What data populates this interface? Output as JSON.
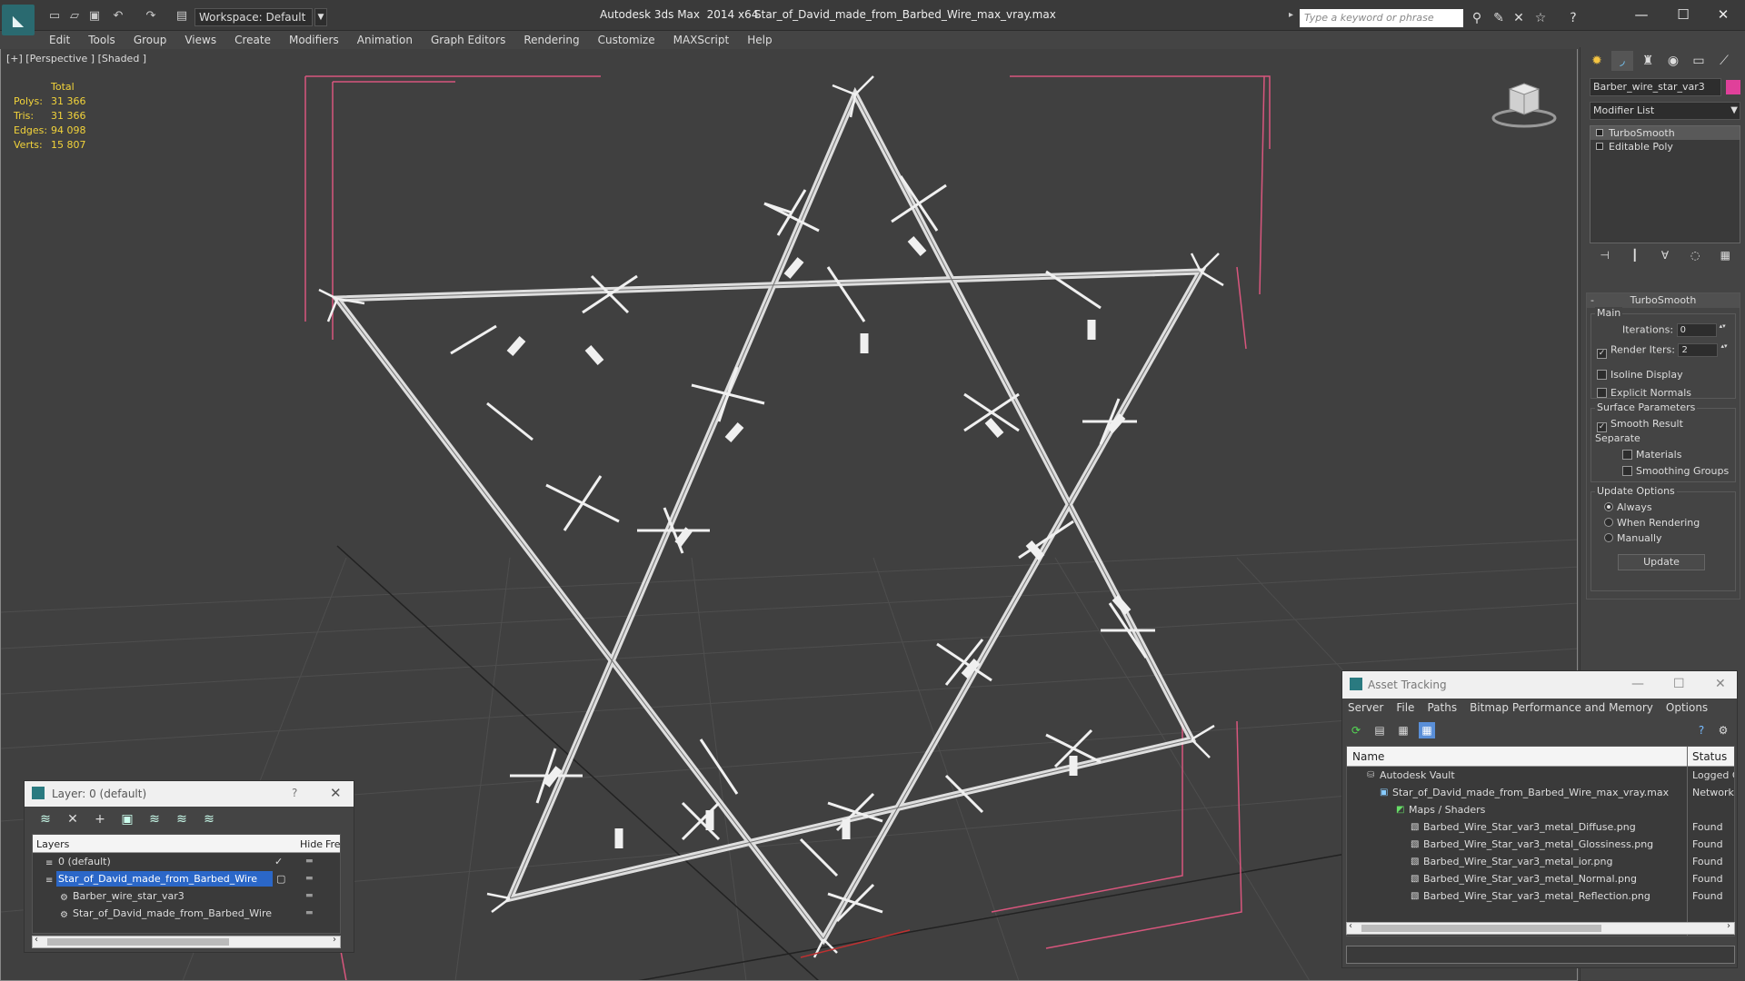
{
  "app": {
    "title": "Autodesk 3ds Max  2014 x64",
    "file_title": "Star_of_David_made_from_Barbed_Wire_max_vray.max",
    "workspace": "Workspace: Default",
    "search_placeholder": "Type a keyword or phrase"
  },
  "menu": [
    "Edit",
    "Tools",
    "Group",
    "Views",
    "Create",
    "Modifiers",
    "Animation",
    "Graph Editors",
    "Rendering",
    "Customize",
    "MAXScript",
    "Help"
  ],
  "viewport": {
    "label": "[+] [Perspective ] [Shaded ]",
    "stats": {
      "header": "Total",
      "rows": [
        {
          "label": "Polys:",
          "value": "31 366"
        },
        {
          "label": "Tris:",
          "value": "31 366"
        },
        {
          "label": "Edges:",
          "value": "94 098"
        },
        {
          "label": "Verts:",
          "value": "15 807"
        }
      ]
    },
    "colors": {
      "background": "#404040",
      "wire": "#f4f4f4",
      "bbox": "#d8567d",
      "stats": "#f2d33a"
    }
  },
  "command_panel": {
    "object_name": "Barber_wire_star_var3",
    "object_color": "#e0409a",
    "modifier_list": "Modifier List",
    "stack": [
      "TurboSmooth",
      "Editable Poly"
    ],
    "rollout": {
      "title": "TurboSmooth",
      "main_group": "Main",
      "iterations_label": "Iterations:",
      "iterations_value": "0",
      "render_iters_label": "Render Iters:",
      "render_iters_value": "2",
      "isoline": "Isoline Display",
      "explicit_normals": "Explicit Normals",
      "surface_group": "Surface Parameters",
      "smooth_result": "Smooth Result",
      "separate": "Separate",
      "materials": "Materials",
      "smoothing_groups": "Smoothing Groups",
      "update_group": "Update Options",
      "always": "Always",
      "when_rendering": "When Rendering",
      "manually": "Manually",
      "update_button": "Update"
    }
  },
  "layer_dialog": {
    "title": "Layer: 0 (default)",
    "help": "?",
    "columns": {
      "layers": "Layers",
      "hide": "Hide",
      "freeze": "Fre"
    },
    "rows": [
      {
        "name": "0 (default)"
      },
      {
        "name": "Star_of_David_made_from_Barbed_Wire"
      },
      {
        "name": "Barber_wire_star_var3"
      },
      {
        "name": "Star_of_David_made_from_Barbed_Wire"
      }
    ]
  },
  "asset_dialog": {
    "title": "Asset Tracking",
    "menu": [
      "Server",
      "File",
      "Paths",
      "Bitmap Performance and Memory",
      "Options"
    ],
    "columns": {
      "name": "Name",
      "status": "Status"
    },
    "rows": [
      {
        "name": "Autodesk Vault",
        "status": "Logged C"
      },
      {
        "name": "Star_of_David_made_from_Barbed_Wire_max_vray.max",
        "status": "Network"
      },
      {
        "name": "Maps / Shaders",
        "status": ""
      },
      {
        "name": "Barbed_Wire_Star_var3_metal_Diffuse.png",
        "status": "Found"
      },
      {
        "name": "Barbed_Wire_Star_var3_metal_Glossiness.png",
        "status": "Found"
      },
      {
        "name": "Barbed_Wire_Star_var3_metal_ior.png",
        "status": "Found"
      },
      {
        "name": "Barbed_Wire_Star_var3_metal_Normal.png",
        "status": "Found"
      },
      {
        "name": "Barbed_Wire_Star_var3_metal_Reflection.png",
        "status": "Found"
      }
    ]
  }
}
